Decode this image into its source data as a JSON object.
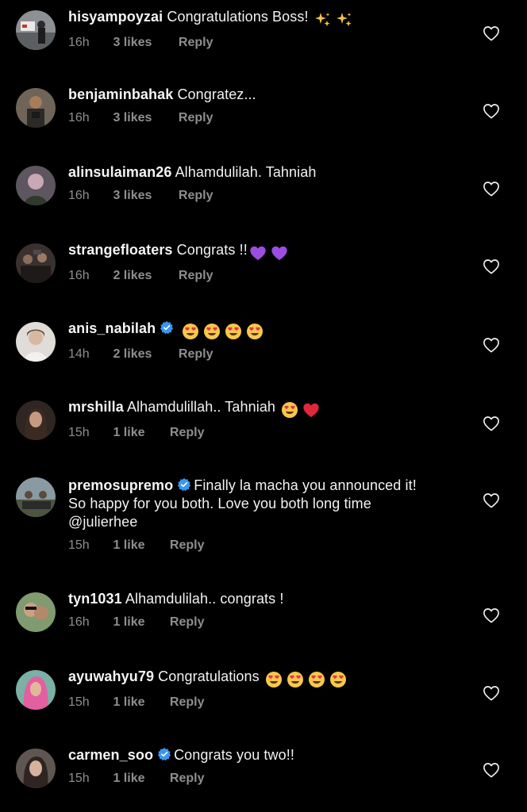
{
  "comments": [
    {
      "username": "hisyampoyzai",
      "verified": false,
      "text": "Congratulations Boss!",
      "emojis": [
        "sparkles",
        "sparkles"
      ],
      "time": "16h",
      "likes": "3 likes",
      "reply": "Reply",
      "avatar_color": "#6b6f73"
    },
    {
      "username": "benjaminbahak",
      "verified": false,
      "text": "Congratez...",
      "emojis": [],
      "time": "16h",
      "likes": "3 likes",
      "reply": "Reply",
      "avatar_color": "#5a5146"
    },
    {
      "username": "alinsulaiman26",
      "verified": false,
      "text": "Alhamdulilah. Tahniah",
      "emojis": [],
      "time": "16h",
      "likes": "3 likes",
      "reply": "Reply",
      "avatar_color": "#7c6a78"
    },
    {
      "username": "strangefloaters",
      "verified": false,
      "text": "Congrats !!",
      "emojis": [
        "purple-heart",
        "purple-heart"
      ],
      "time": "16h",
      "likes": "2 likes",
      "reply": "Reply",
      "avatar_color": "#3d3432"
    },
    {
      "username": "anis_nabilah",
      "verified": true,
      "text": "",
      "emojis": [
        "heart-eyes",
        "heart-eyes",
        "heart-eyes",
        "heart-eyes"
      ],
      "time": "14h",
      "likes": "2 likes",
      "reply": "Reply",
      "avatar_color": "#cfcac6"
    },
    {
      "username": "mrshilla",
      "verified": false,
      "text": "Alhamdulillah.. Tahniah",
      "emojis": [
        "heart-eyes",
        "red-heart"
      ],
      "time": "15h",
      "likes": "1 like",
      "reply": "Reply",
      "avatar_color": "#4a3b36"
    },
    {
      "username": "premosupremo",
      "verified": true,
      "text": "Finally la macha you announced it!",
      "text_line2": "So happy for you both. Love you both long time",
      "text_line3": "@julierhee",
      "emojis": [],
      "time": "15h",
      "likes": "1 like",
      "reply": "Reply",
      "avatar_color": "#56604f"
    },
    {
      "username": "tyn1031",
      "verified": false,
      "text": "Alhamdulilah.. congrats !",
      "emojis": [],
      "time": "16h",
      "likes": "1 like",
      "reply": "Reply",
      "avatar_color": "#7a8a6a"
    },
    {
      "username": "ayuwahyu79",
      "verified": false,
      "text": "Congratulations",
      "emojis": [
        "heart-eyes",
        "heart-eyes",
        "heart-eyes",
        "heart-eyes"
      ],
      "time": "15h",
      "likes": "1 like",
      "reply": "Reply",
      "avatar_color": "#c9569a"
    },
    {
      "username": "carmen_soo",
      "verified": true,
      "text": "Congrats you two!!",
      "emojis": [],
      "time": "15h",
      "likes": "1 like",
      "reply": "Reply",
      "avatar_color": "#5b514c"
    }
  ],
  "colors": {
    "background": "#000000",
    "text": "#f2f2f2",
    "secondary": "#8e8e8e",
    "verified": "#3897f0"
  }
}
